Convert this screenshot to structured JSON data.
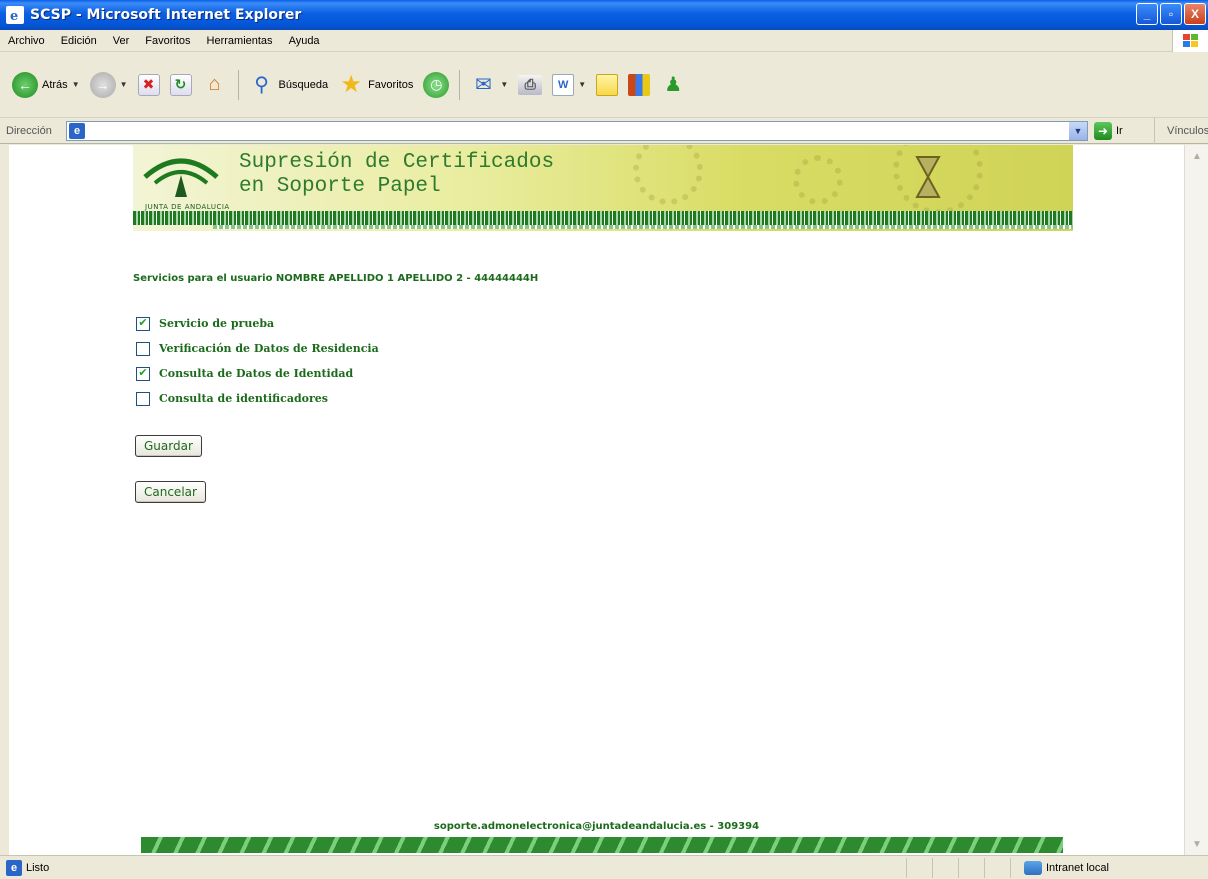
{
  "window": {
    "title": "SCSP - Microsoft Internet Explorer",
    "controls": {
      "minimize": "_",
      "maximize": "▫",
      "close": "X"
    }
  },
  "menu": {
    "items": [
      "Archivo",
      "Edición",
      "Ver",
      "Favoritos",
      "Herramientas",
      "Ayuda"
    ]
  },
  "toolbar": {
    "back_label": "Atrás",
    "search_label": "Búsqueda",
    "favorites_label": "Favoritos"
  },
  "address": {
    "label": "Dirección",
    "value": "",
    "go_label": "Ir",
    "links_label": "Vínculos"
  },
  "banner": {
    "title_line1": "Supresión de Certificados",
    "title_line2": "en Soporte Papel",
    "logo_text": "JUNTA DE ANDALUCIA"
  },
  "form": {
    "user_line": "Servicios para el usuario NOMBRE APELLIDO 1 APELLIDO 2 - 44444444H",
    "services": [
      {
        "label": "Servicio de prueba",
        "checked": true
      },
      {
        "label": "Verificación de Datos de Residencia",
        "checked": false
      },
      {
        "label": "Consulta de Datos de Identidad",
        "checked": true
      },
      {
        "label": "Consulta de identificadores",
        "checked": false
      }
    ],
    "save_label": "Guardar",
    "cancel_label": "Cancelar"
  },
  "footer": {
    "text": "soporte.admonelectronica@juntadeandalucia.es - 309394"
  },
  "status": {
    "text": "Listo",
    "zone": "Intranet local"
  },
  "colors": {
    "accent_green": "#1c6b1c",
    "titlebar_blue": "#0456d6"
  }
}
